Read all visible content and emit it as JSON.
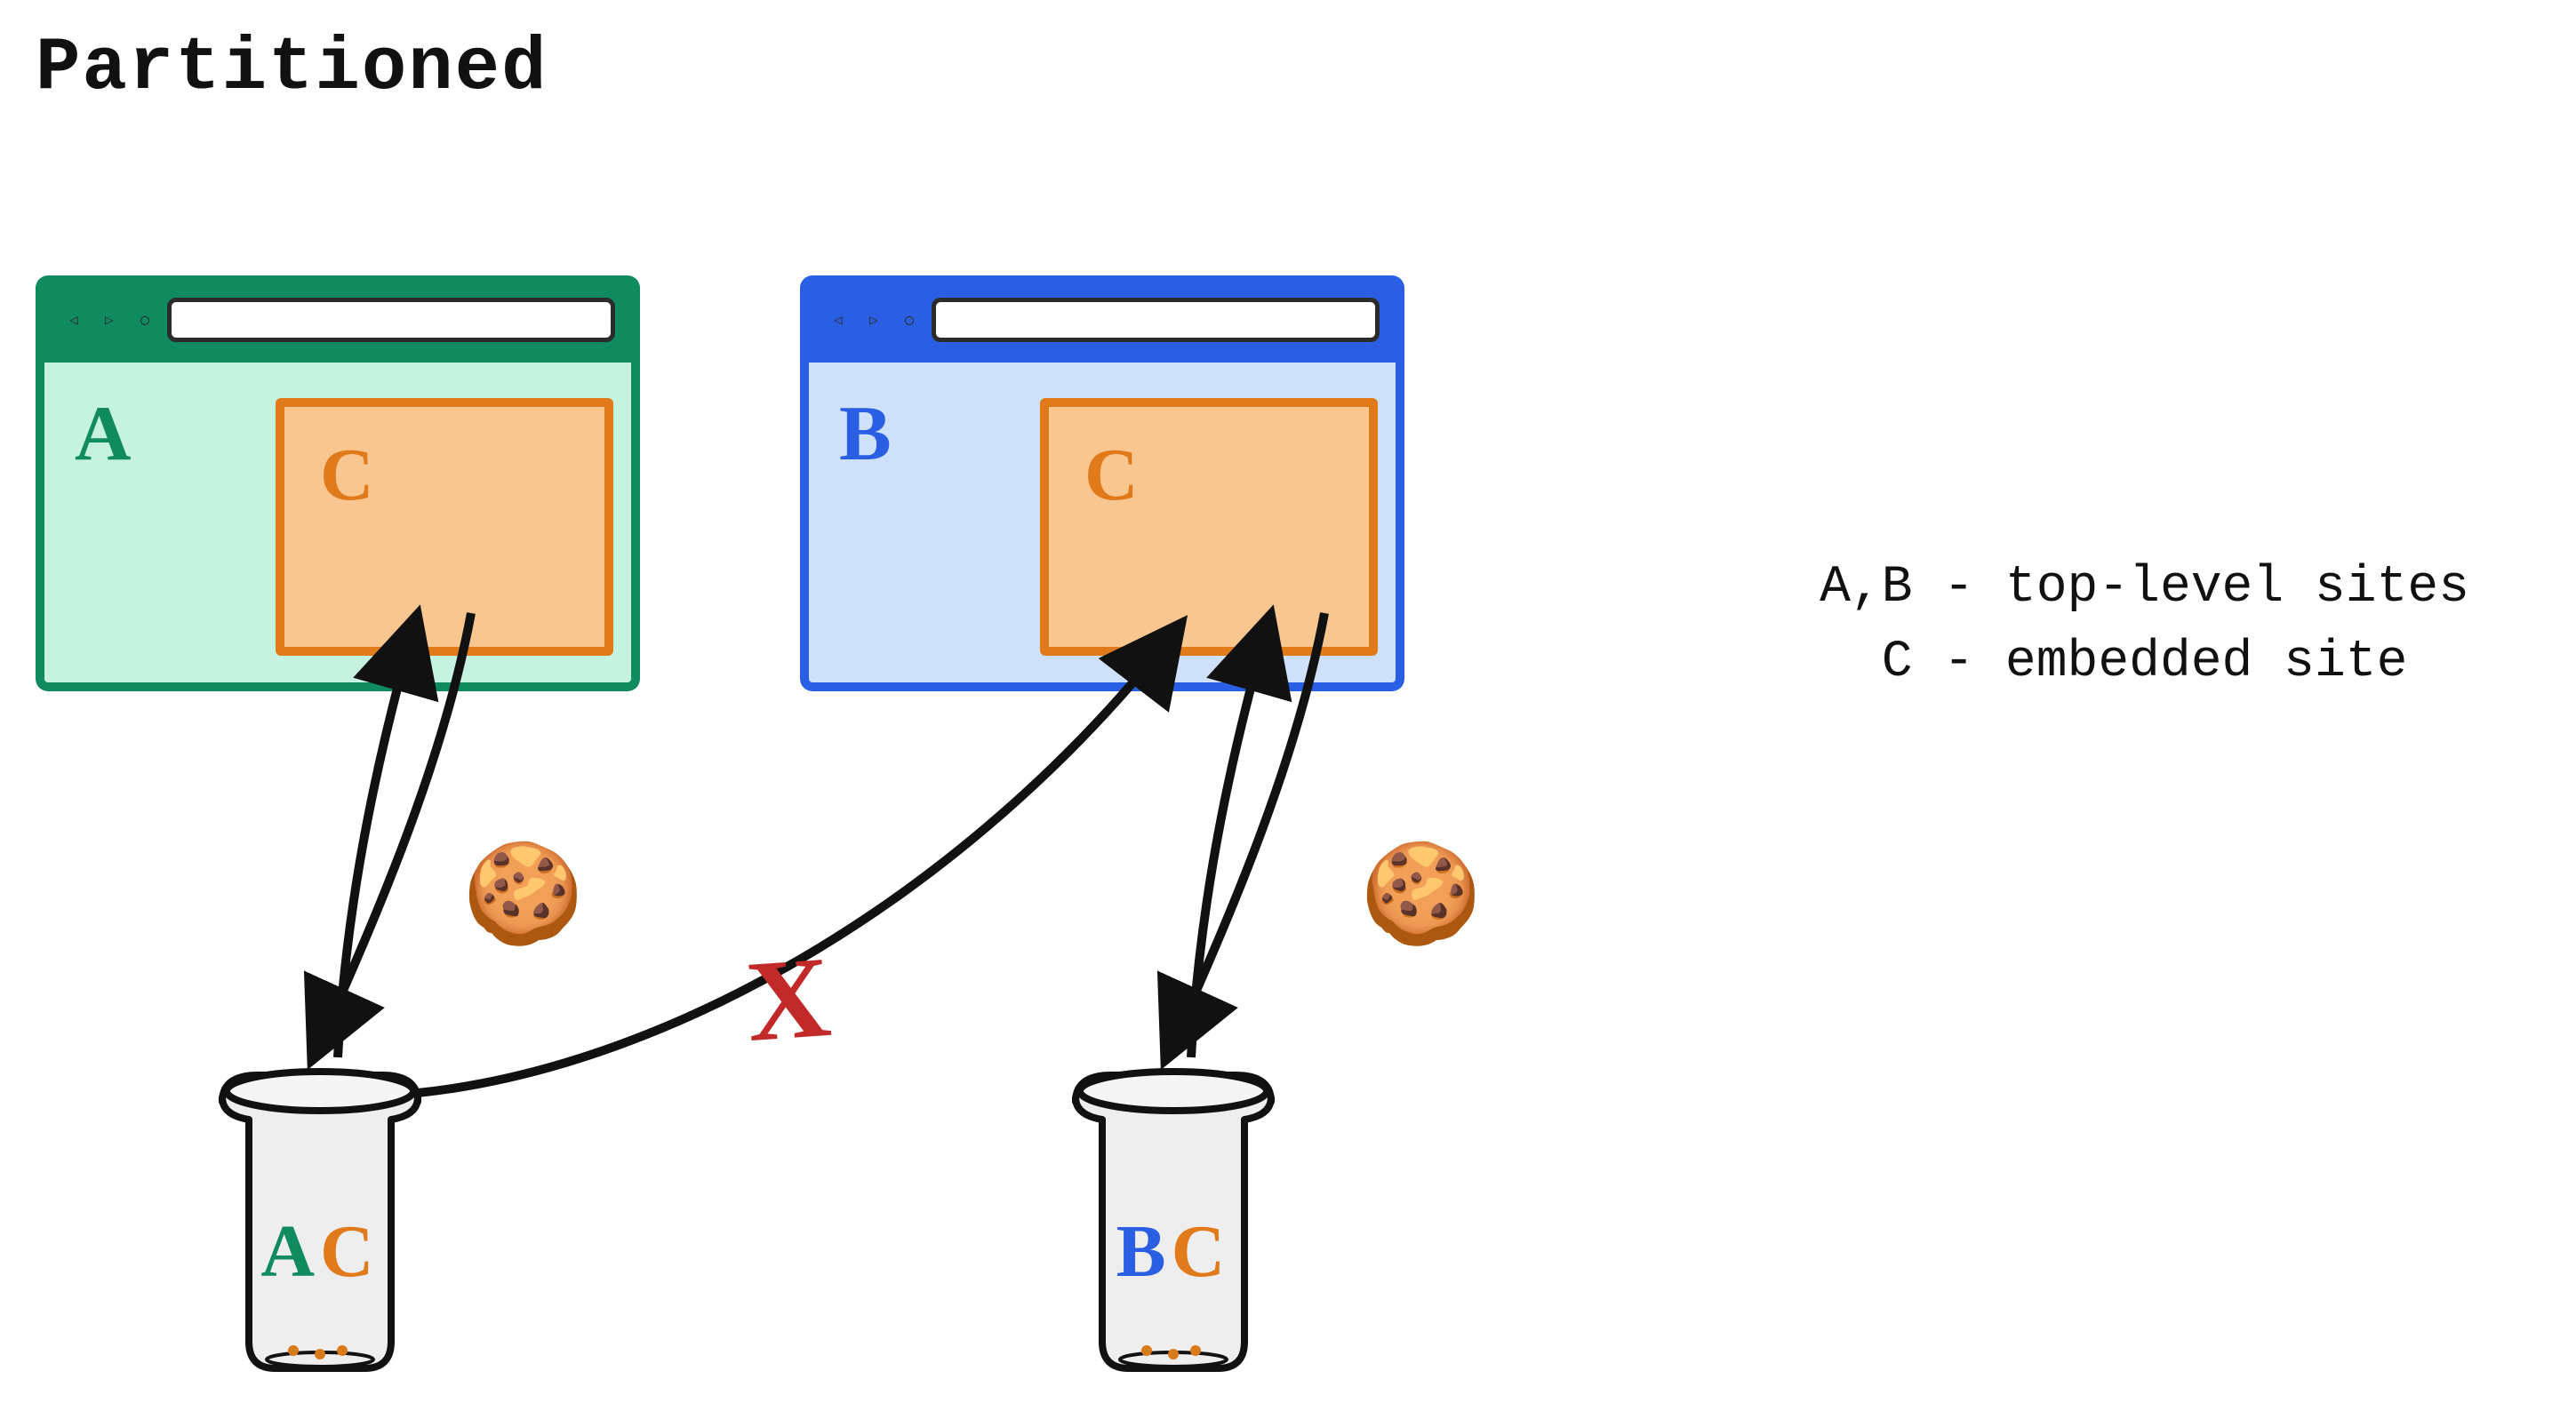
{
  "title": "Partitioned",
  "legend": {
    "line1": "A,B - top-level sites",
    "line2": "  C - embedded site"
  },
  "browsers": {
    "A": {
      "label": "A",
      "color": "#0f8b5f",
      "bg": "#c6f3e1",
      "iframe": {
        "label": "C",
        "color": "#e07a1b"
      }
    },
    "B": {
      "label": "B",
      "color": "#2b5fe3",
      "bg": "#cfe0fb",
      "iframe": {
        "label": "C",
        "color": "#e07a1b"
      }
    }
  },
  "nav_icons": {
    "back": "◁",
    "forward": "▷",
    "reload": "◯"
  },
  "jars": {
    "A": {
      "partition_top": "A",
      "partition_embed": "C"
    },
    "B": {
      "partition_top": "B",
      "partition_embed": "C"
    }
  },
  "cookie_glyph": "🍪",
  "blocked_marker": "X",
  "arrows": {
    "jarA_to_iframeA": "bidirectional",
    "jarB_to_iframeB": "bidirectional",
    "jarA_to_iframeB": "blocked"
  }
}
